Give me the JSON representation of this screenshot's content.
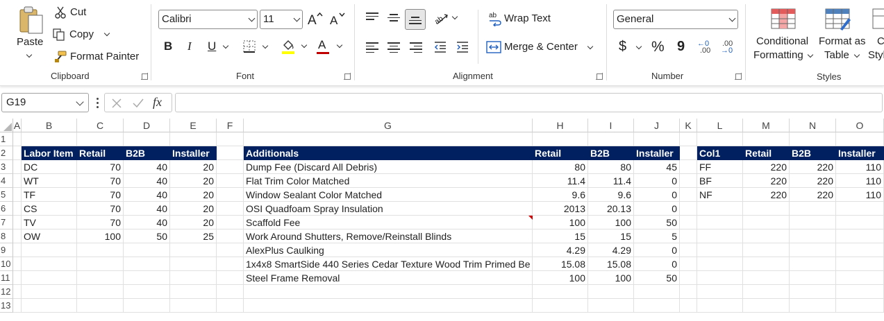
{
  "ribbon": {
    "clipboard": {
      "paste": "Paste",
      "cut": "Cut",
      "copy": "Copy",
      "format_painter": "Format Painter",
      "label": "Clipboard"
    },
    "font": {
      "font_name": "Calibri",
      "font_size": "11",
      "grow": "A^",
      "shrink": "Aˇ",
      "bold": "B",
      "italic": "I",
      "underline": "U",
      "font_color": "A",
      "label": "Font"
    },
    "alignment": {
      "wrap_text": "Wrap Text",
      "merge_center": "Merge & Center",
      "label": "Alignment"
    },
    "number": {
      "format": "General",
      "currency": "$",
      "percent": "%",
      "comma": "9",
      "inc_decimal_top": "←0",
      "inc_decimal_bottom": ".00",
      "dec_decimal_top": ".00",
      "dec_decimal_bottom": "→0",
      "label": "Number"
    },
    "styles": {
      "conditional_1": "Conditional",
      "conditional_2": "Formatting",
      "format_table_1": "Format as",
      "format_table_2": "Table",
      "cell_styles_1": "C",
      "cell_styles_2": "Styl",
      "label": "Styles"
    }
  },
  "formula_bar": {
    "name_box": "G19",
    "fx": "fx",
    "formula": ""
  },
  "grid": {
    "columns": [
      "A",
      "B",
      "C",
      "D",
      "E",
      "F",
      "G",
      "H",
      "I",
      "J",
      "K",
      "L",
      "M",
      "N",
      "O"
    ],
    "rows": [
      "1",
      "2",
      "3",
      "4",
      "5",
      "6",
      "7",
      "8",
      "9",
      "10",
      "11",
      "12",
      "13"
    ],
    "table1": {
      "headers": [
        "Labor Item",
        "Retail",
        "B2B",
        "Installer"
      ],
      "rows": [
        [
          "DC",
          "70",
          "40",
          "20"
        ],
        [
          "WT",
          "70",
          "40",
          "20"
        ],
        [
          "TF",
          "70",
          "40",
          "20"
        ],
        [
          "CS",
          "70",
          "40",
          "20"
        ],
        [
          "TV",
          "70",
          "40",
          "20"
        ],
        [
          "OW",
          "100",
          "50",
          "25"
        ]
      ]
    },
    "table2": {
      "headers": [
        "Additionals",
        "Retail",
        "B2B",
        "Installer"
      ],
      "rows": [
        [
          "Dump Fee (Discard All Debris)",
          "80",
          "80",
          "45"
        ],
        [
          "Flat Trim Color Matched",
          "11.4",
          "11.4",
          "0"
        ],
        [
          "Window Sealant Color Matched",
          "9.6",
          "9.6",
          "0"
        ],
        [
          "OSI Quadfoam Spray Insulation",
          "2013",
          "20.13",
          "0"
        ],
        [
          "Scaffold Fee",
          "100",
          "100",
          "50"
        ],
        [
          "Work Around Shutters, Remove/Reinstall Blinds",
          "15",
          "15",
          "5"
        ],
        [
          "AlexPlus Caulking",
          "4.29",
          "4.29",
          "0"
        ],
        [
          "1x4x8 SmartSide 440 Series Cedar Texture Wood Trim Primed Be",
          "15.08",
          "15.08",
          "0"
        ],
        [
          "Steel Frame Removal",
          "100",
          "100",
          "50"
        ]
      ]
    },
    "table3": {
      "headers": [
        "Col1",
        "Retail",
        "B2B",
        "Installer"
      ],
      "rows": [
        [
          "FF",
          "220",
          "220",
          "110"
        ],
        [
          "BF",
          "220",
          "220",
          "110"
        ],
        [
          "NF",
          "220",
          "220",
          "110"
        ]
      ]
    },
    "colors": {
      "header_fill": "#002060",
      "header_text": "#ffffff",
      "comment_indicator": "#d00000"
    }
  }
}
